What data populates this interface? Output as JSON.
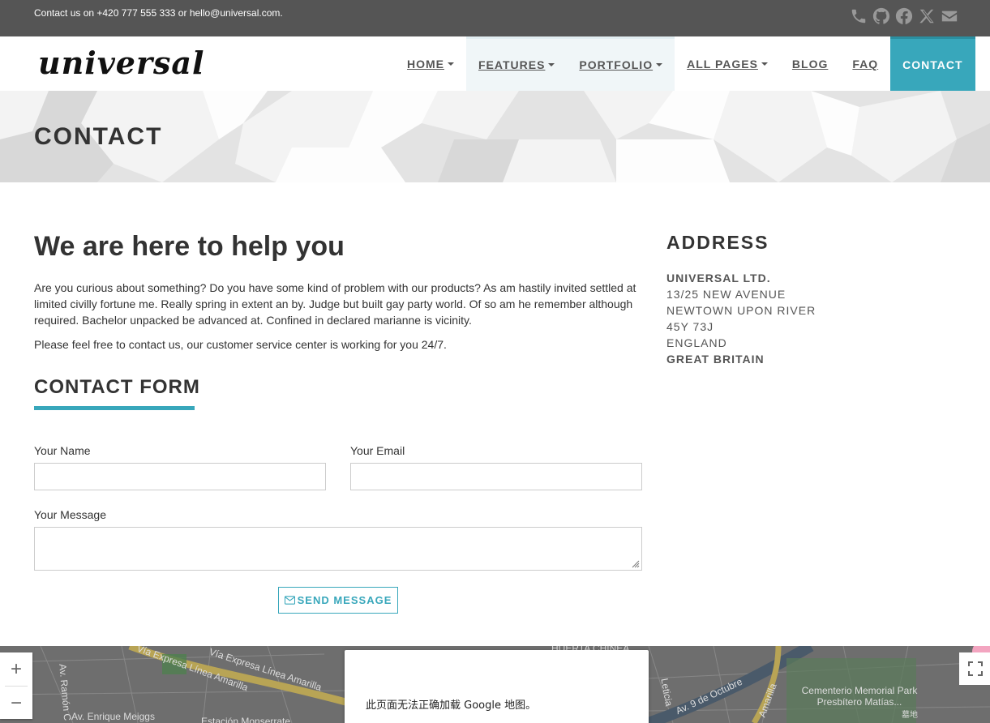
{
  "topbar": {
    "text": "Contact us on +420 777 555 333 or hello@universal.com.",
    "social_icons": [
      "phone-icon",
      "github-icon",
      "facebook-icon",
      "x-icon",
      "envelope-icon"
    ]
  },
  "logo": "universal",
  "nav": {
    "home": "HOME",
    "features": "FEATURES",
    "portfolio": "PORTFOLIO",
    "all_pages": "ALL PAGES",
    "blog": "BLOG",
    "faq": "FAQ",
    "contact": "CONTACT"
  },
  "page_title": "CONTACT",
  "main": {
    "heading": "We are here to help you",
    "paragraph1": "Are you curious about something? Do you have some kind of problem with our products? As am hastily invited settled at limited civilly fortune me. Really spring in extent an by. Judge but built gay party world. Of so am he remember although required. Bachelor unpacked be advanced at. Confined in declared marianne is vicinity.",
    "paragraph2": "Please feel free to contact us, our customer service center is working for you 24/7."
  },
  "form": {
    "title": "CONTACT FORM",
    "name_label": "Your Name",
    "name_value": "",
    "email_label": "Your Email",
    "email_value": "",
    "message_label": "Your Message",
    "message_value": "",
    "send_label": "SEND MESSAGE"
  },
  "address": {
    "title": "ADDRESS",
    "company": "UNIVERSAL LTD.",
    "line1": "13/25 NEW AVENUE",
    "line2": "NEWTOWN UPON RIVER",
    "line3": "45Y 73J",
    "line4": "ENGLAND",
    "country": "GREAT BRITAIN"
  },
  "map": {
    "error_message": "此页面无法正确加载 Google 地图。",
    "zoom_in": "+",
    "zoom_out": "−",
    "labels": {
      "via_expresa_1": "Vía Expresa Línea Amarilla",
      "via_expresa_2": "Vía Expresa Línea Amarilla",
      "av_ramon": "Av. Ramón C",
      "av_enrique": "Av. Enrique Meiggs",
      "estacion": "Estación Monserrate",
      "huerta": "HUERTA CHINEA",
      "leticia": "Leticia",
      "av_9_octubre": "Av. 9 de Octubre",
      "amarilla": "Amarilla",
      "cementerio": "Cementerio Memorial Park Presbítero Matías...",
      "cemetery_zh": "墓地"
    }
  },
  "colors": {
    "accent": "#38a7bb",
    "topbar_bg": "#555555",
    "text": "#333333"
  }
}
